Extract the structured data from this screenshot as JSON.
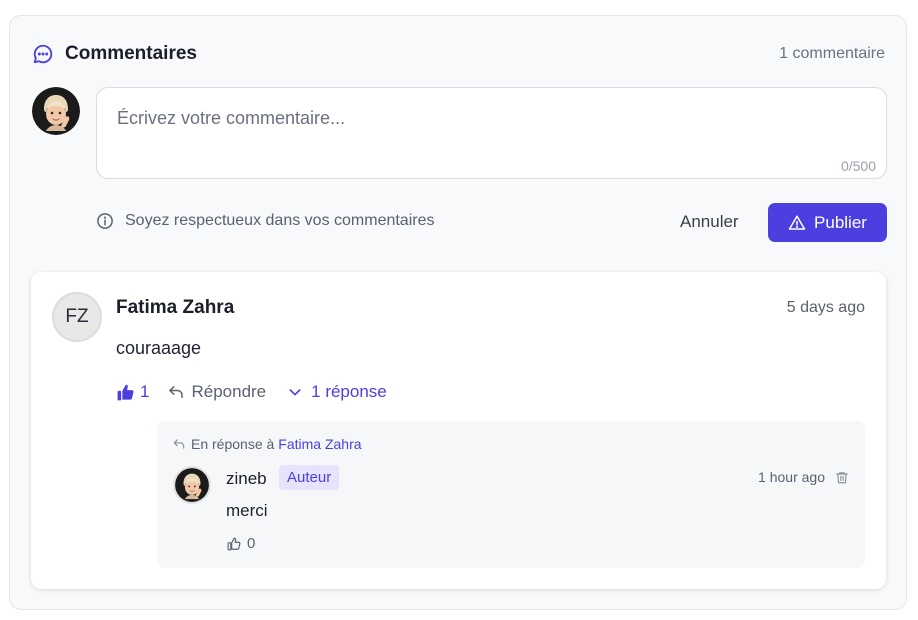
{
  "header": {
    "title": "Commentaires",
    "count": "1 commentaire",
    "icon": "chat-bubble-icon"
  },
  "composer": {
    "placeholder": "Écrivez votre commentaire...",
    "counter": "0/500",
    "hint": "Soyez respectueux dans vos commentaires",
    "cancel_label": "Annuler",
    "publish_label": "Publier"
  },
  "comment": {
    "avatar_initials": "FZ",
    "author": "Fatima Zahra",
    "time": "5 days ago",
    "text": "couraaage",
    "likes": "1",
    "reply_label": "Répondre",
    "replies_toggle": "1 réponse"
  },
  "reply": {
    "in_reply_prefix": "En réponse à",
    "in_reply_name": "Fatima Zahra",
    "author": "zineb",
    "badge": "Auteur",
    "time": "1 hour ago",
    "text": "merci",
    "likes": "0"
  },
  "colors": {
    "accent": "#4c3fe0",
    "badge_bg": "#e6e3fb"
  }
}
